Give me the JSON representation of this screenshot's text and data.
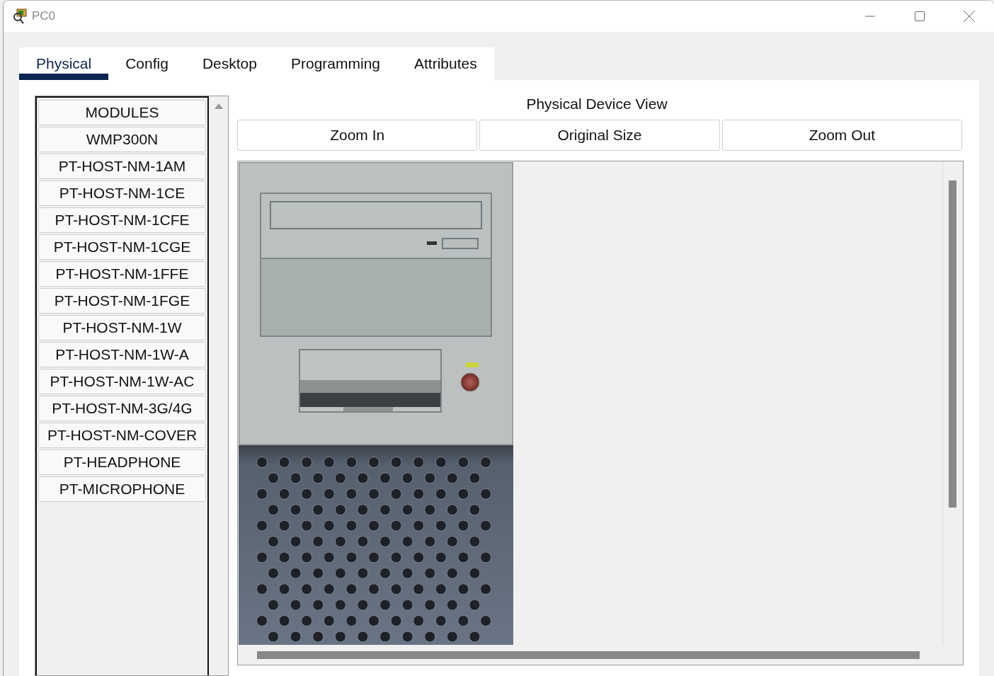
{
  "window": {
    "title": "PC0"
  },
  "tabs": [
    {
      "label": "Physical",
      "selected": true
    },
    {
      "label": "Config",
      "selected": false
    },
    {
      "label": "Desktop",
      "selected": false
    },
    {
      "label": "Programming",
      "selected": false
    },
    {
      "label": "Attributes",
      "selected": false
    }
  ],
  "modules": [
    "MODULES",
    "WMP300N",
    "PT-HOST-NM-1AM",
    "PT-HOST-NM-1CE",
    "PT-HOST-NM-1CFE",
    "PT-HOST-NM-1CGE",
    "PT-HOST-NM-1FFE",
    "PT-HOST-NM-1FGE",
    "PT-HOST-NM-1W",
    "PT-HOST-NM-1W-A",
    "PT-HOST-NM-1W-AC",
    "PT-HOST-NM-3G/4G",
    "PT-HOST-NM-COVER",
    "PT-HEADPHONE",
    "PT-MICROPHONE"
  ],
  "device_view": {
    "title": "Physical Device View",
    "buttons": [
      "Zoom In",
      "Original Size",
      "Zoom Out"
    ]
  }
}
